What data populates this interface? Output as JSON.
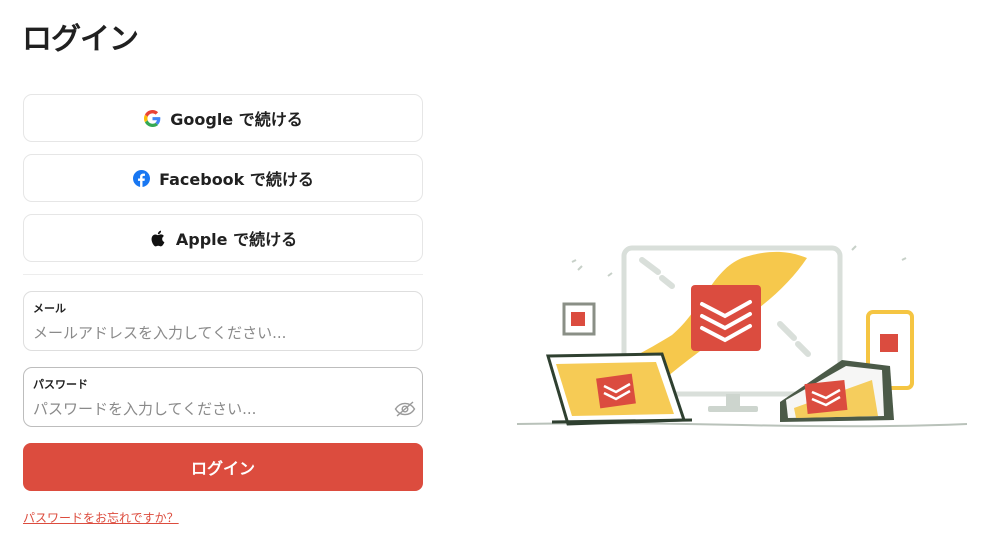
{
  "page_title": "ログイン",
  "sso": {
    "google_label": "Google で続ける",
    "facebook_label": "Facebook で続ける",
    "apple_label": "Apple で続ける"
  },
  "email": {
    "label": "メール",
    "placeholder": "メールアドレスを入力してください..."
  },
  "password": {
    "label": "パスワード",
    "placeholder": "パスワードを入力してください..."
  },
  "login_button": "ログイン",
  "forgot_password": "パスワードをお忘れですか？",
  "colors": {
    "accent": "#dc4c3e",
    "facebook": "#1877f2",
    "illustration_yellow": "#f5c542"
  },
  "icons": [
    "google-icon",
    "facebook-icon",
    "apple-icon",
    "eye-off-icon",
    "todoist-logo"
  ]
}
